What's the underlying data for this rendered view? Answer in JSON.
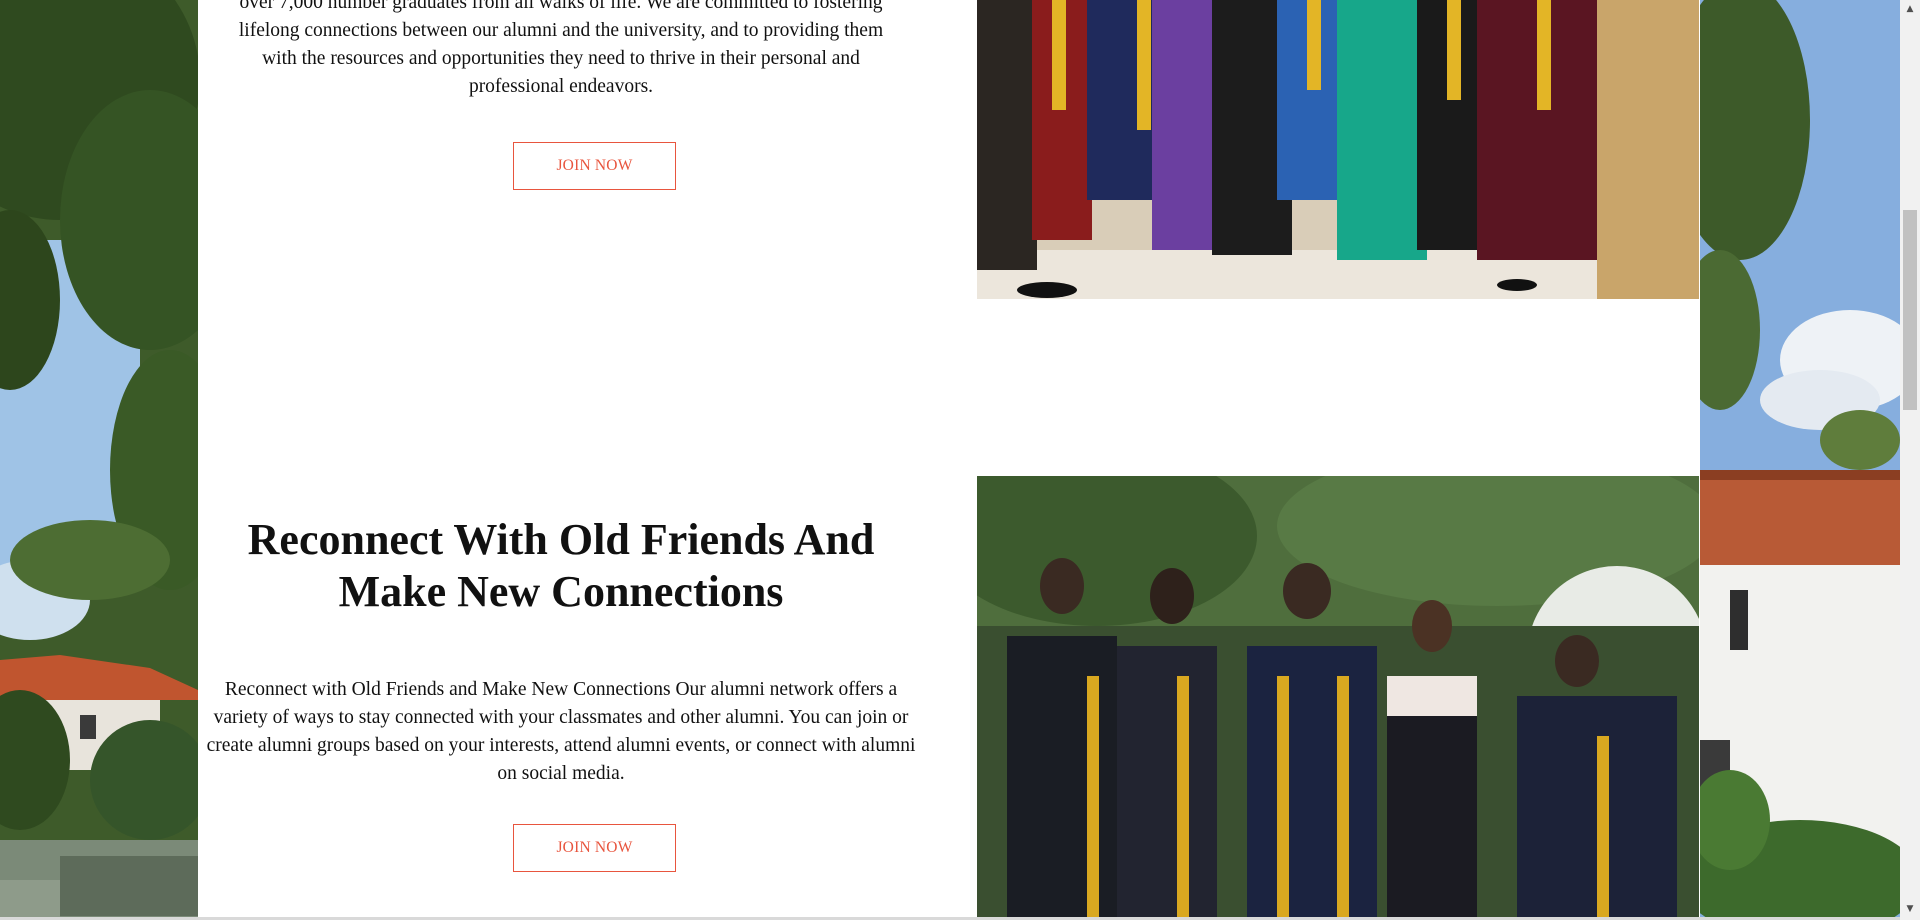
{
  "section_top": {
    "paragraph_lines": [
      "over 7,000 number graduates from all walks of life. We are committed to fostering",
      "lifelong connections between our alumni and the university, and to providing them",
      "with the resources and opportunities they need to thrive in their personal and",
      "professional endeavors."
    ],
    "button_label": "JOIN NOW"
  },
  "section_reconnect": {
    "heading": "Reconnect With Old Friends And Make New Connections",
    "paragraph": "Reconnect with Old Friends and Make New Connections Our alumni network offers a variety of ways to stay connected with your classmates and other alumni. You can join or create alumni groups based on your interests, attend alumni events, or connect with alumni on social media.",
    "button_label": "JOIN NOW"
  },
  "images": {
    "top": "graduates-group-photo",
    "bottom": "graduates-in-gowns-photo",
    "background": "campus-buildings-trees"
  },
  "colors": {
    "accent": "#e8553e",
    "text": "#111111",
    "content_bg": "#ffffff"
  }
}
